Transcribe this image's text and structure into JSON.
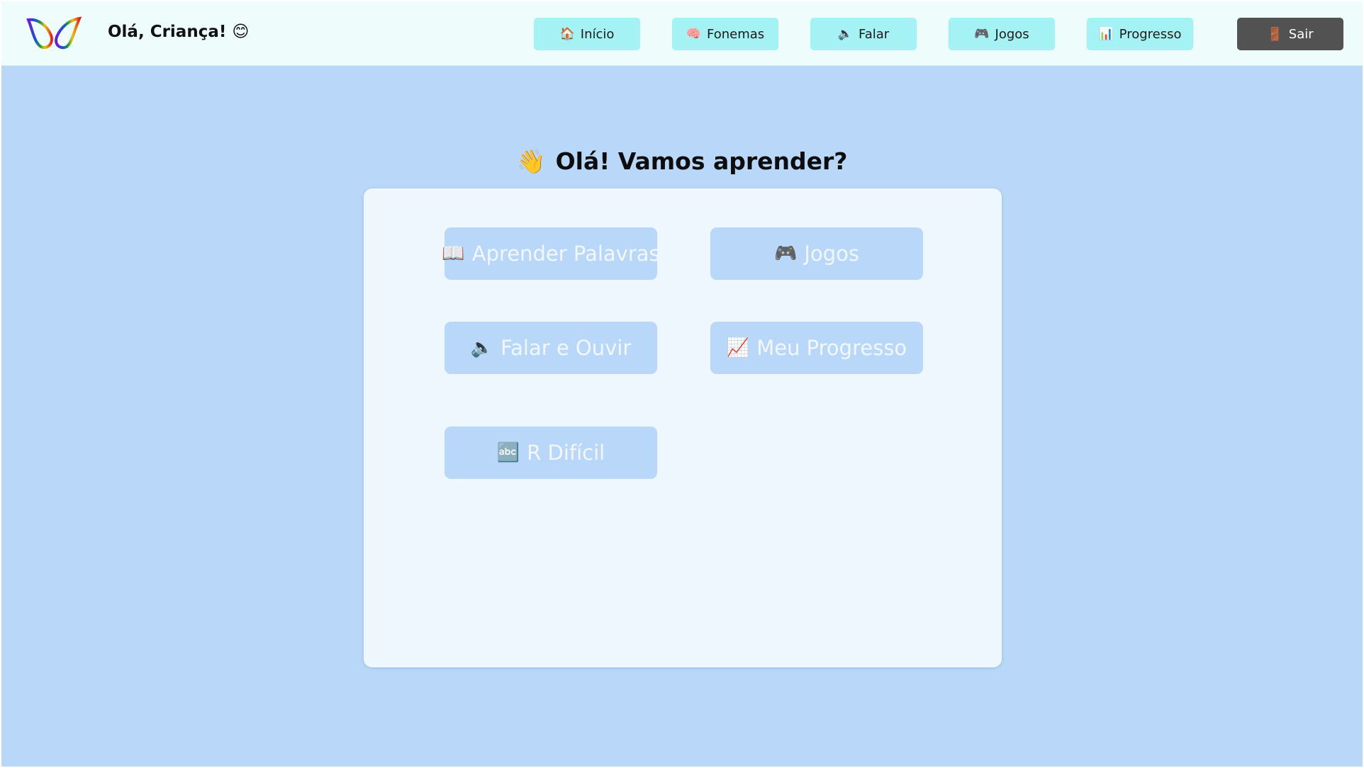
{
  "header": {
    "greeting": "Olá, Criança! 😊",
    "nav": [
      {
        "icon": "🏠",
        "label": "Início"
      },
      {
        "icon": "🧠",
        "label": "Fonemas"
      },
      {
        "icon": "🔈",
        "label": "Falar"
      },
      {
        "icon": "🎮",
        "label": "Jogos"
      },
      {
        "icon": "📊",
        "label": "Progresso"
      }
    ],
    "exit": {
      "icon": "🚪",
      "label": "Sair"
    }
  },
  "main": {
    "title_icon": "👋",
    "title": "Olá! Vamos aprender?",
    "buttons": [
      {
        "icon": "📖",
        "label": "Aprender Palavras"
      },
      {
        "icon": "🎮",
        "label": "Jogos"
      },
      {
        "icon": "🔈",
        "label": "Falar e Ouvir"
      },
      {
        "icon": "📈",
        "label": "Meu Progresso"
      },
      {
        "icon": "🔤",
        "label": "R Difícil"
      }
    ]
  },
  "colors": {
    "page_background": "#b9d7f8",
    "header_background": "#eefcfc",
    "nav_button": "#a5f2f4",
    "exit_button": "#525252",
    "card_background": "#eef6fe",
    "menu_button": "#b9d7f8"
  }
}
